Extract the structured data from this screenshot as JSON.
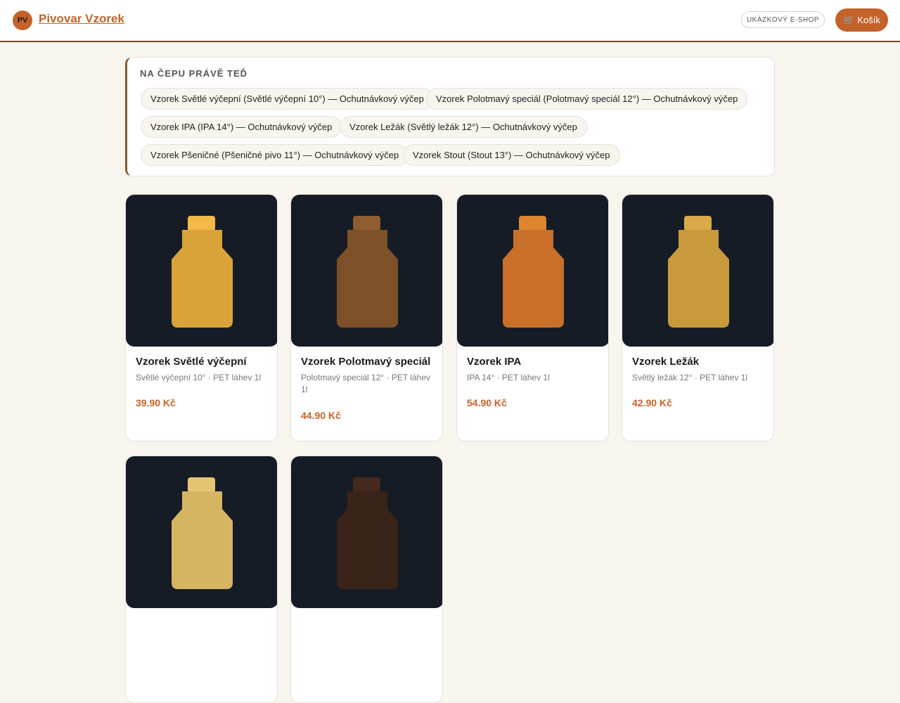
{
  "header": {
    "logo_initials": "PV",
    "brand": "Pivovar Vzorek",
    "badge": "UKÁZKOVÝ E-SHOP",
    "cart_icon": "🛒",
    "cart_label": "Košík"
  },
  "on_tap": {
    "title": "NA ČEPU PRÁVĚ TEĎ",
    "chips": [
      "Vzorek Světlé výčepní (Světlé výčepní 10°) — Ochutnávkový výčep",
      "Vzorek Polotmavý speciál (Polotmavý speciál 12°) — Ochutnávkový výčep",
      "Vzorek IPA (IPA 14°) — Ochutnávkový výčep",
      "Vzorek Ležák (Světlý ležák 12°) — Ochutnávkový výčep",
      "Vzorek Pšeničné (Pšeničné pivo 11°) — Ochutnávkový výčep",
      "Vzorek Stout (Stout 13°) — Ochutnávkový výčep"
    ]
  },
  "products": [
    {
      "name": "Vzorek Světlé výčepní",
      "desc": "Světlé výčepní 10° · PET láhev 1l",
      "price": "39.90 Kč",
      "body_color": "#d9a33a",
      "cap_color": "#f0b948",
      "icon": "bottle-icon"
    },
    {
      "name": "Vzorek Polotmavý speciál",
      "desc": "Polotmavý speciál 12° · PET láhev 1l",
      "price": "44.90 Kč",
      "body_color": "#7d5028",
      "cap_color": "#8e5d30",
      "icon": "bottle-icon"
    },
    {
      "name": "Vzorek IPA",
      "desc": "IPA 14° · PET láhev 1l",
      "price": "54.90 Kč",
      "body_color": "#c8702a",
      "cap_color": "#de8530",
      "icon": "bottle-icon"
    },
    {
      "name": "Vzorek Ležák",
      "desc": "Světlý ležák 12° · PET láhev 1l",
      "price": "42.90 Kč",
      "body_color": "#c89a3c",
      "cap_color": "#d8ab48",
      "icon": "bottle-icon"
    },
    {
      "name": "",
      "desc": "",
      "price": "",
      "body_color": "#d6b562",
      "cap_color": "#e6c572",
      "icon": "bottle-icon"
    },
    {
      "name": "",
      "desc": "",
      "price": "",
      "body_color": "#3a2318",
      "cap_color": "#45291c",
      "icon": "bottle-icon"
    }
  ]
}
